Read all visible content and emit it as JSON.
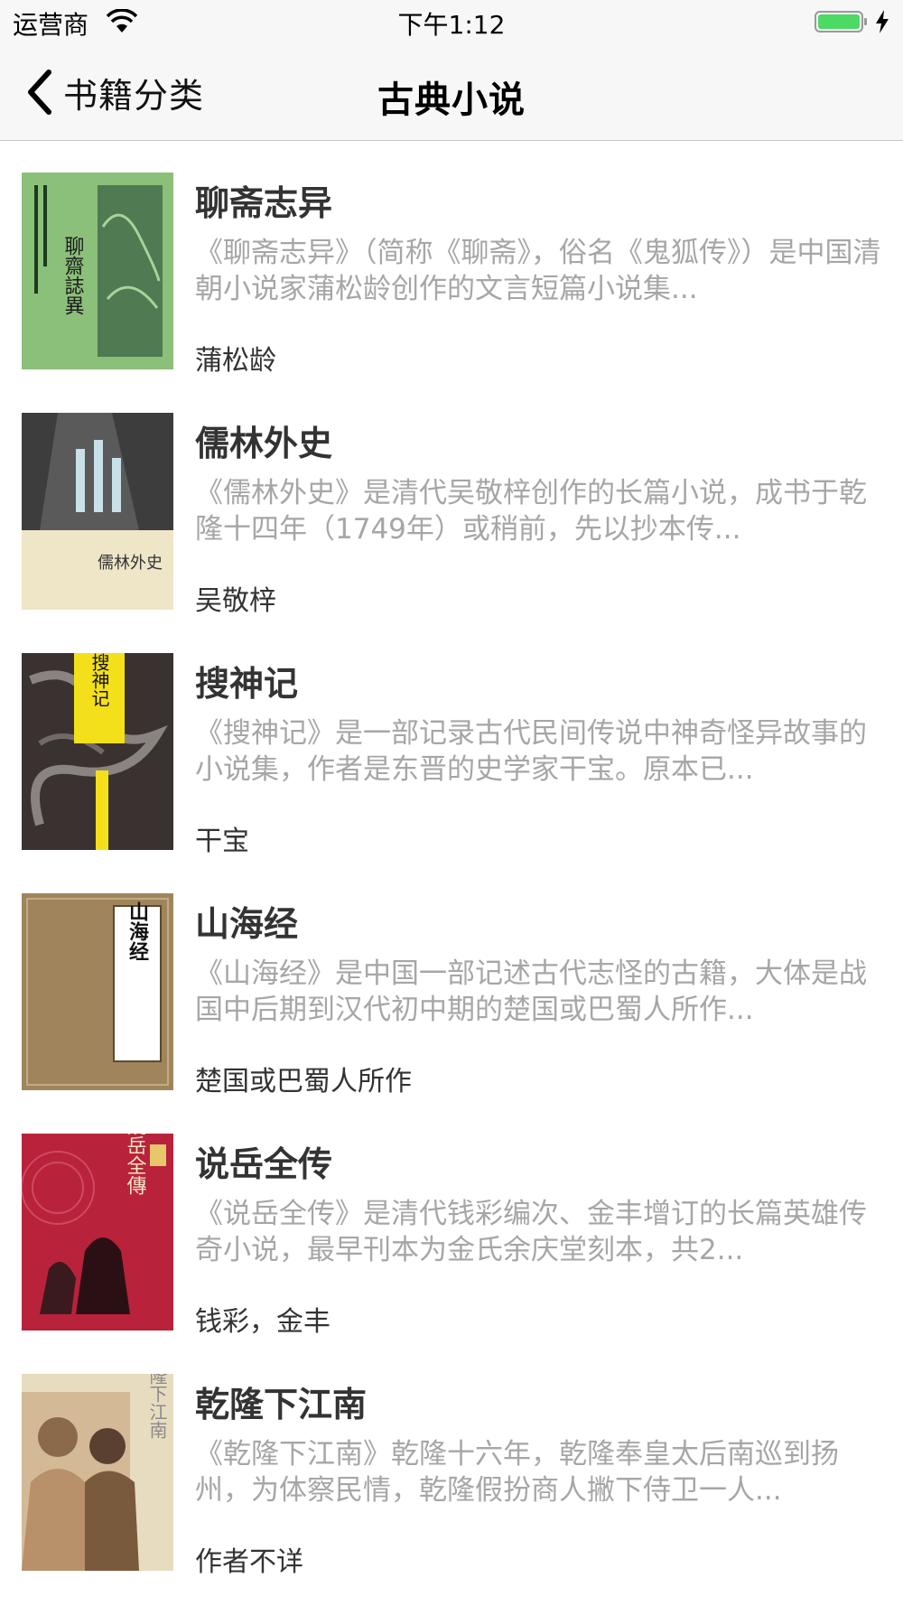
{
  "status_bar": {
    "carrier": "运营商",
    "time": "下午1:12",
    "wifi_icon": "wifi-icon",
    "battery_icon": "battery-charging-icon",
    "battery_color": "#4cd964"
  },
  "nav": {
    "back_label": "书籍分类",
    "title": "古典小说",
    "back_icon": "chevron-left-icon"
  },
  "books": [
    {
      "title": "聊斋志异",
      "description": "《聊斋志异》（简称《聊斋》，俗名《鬼狐传》）是中国清朝小说家蒲松龄创作的文言短篇小说集...",
      "author": "蒲松龄",
      "cover_text": "聊齋誌異",
      "cover_color": "#8bc07a"
    },
    {
      "title": "儒林外史",
      "description": "《儒林外史》是清代吴敬梓创作的长篇小说，成书于乾隆十四年（1749年）或稍前，先以抄本传...",
      "author": "吴敬梓",
      "cover_text": "儒林外史",
      "cover_color": "#efe6c8"
    },
    {
      "title": "搜神记",
      "description": "《搜神记》是一部记录古代民间传说中神奇怪异故事的小说集，作者是东晋的史学家干宝。原本已...",
      "author": "干宝",
      "cover_text": "搜神记",
      "cover_color": "#3a3230"
    },
    {
      "title": "山海经",
      "description": "《山海经》是中国一部记述古代志怪的古籍，大体是战国中后期到汉代初中期的楚国或巴蜀人所作...",
      "author": "楚国或巴蜀人所作",
      "cover_text": "山海经",
      "cover_color": "#a0855c"
    },
    {
      "title": "说岳全传",
      "description": "《说岳全传》是清代钱彩编次、金丰增订的长篇英雄传奇小说，最早刊本为金氏余庆堂刻本，共2...",
      "author": "钱彩，金丰",
      "cover_text": "說岳全傳",
      "cover_color": "#b8223a"
    },
    {
      "title": "乾隆下江南",
      "description": "《乾隆下江南》乾隆十六年，乾隆奉皇太后南巡到扬州，为体察民情，乾隆假扮商人撇下侍卫一人...",
      "author": "作者不详",
      "cover_text": "乾隆下江南",
      "cover_color": "#e8dcc0"
    }
  ]
}
